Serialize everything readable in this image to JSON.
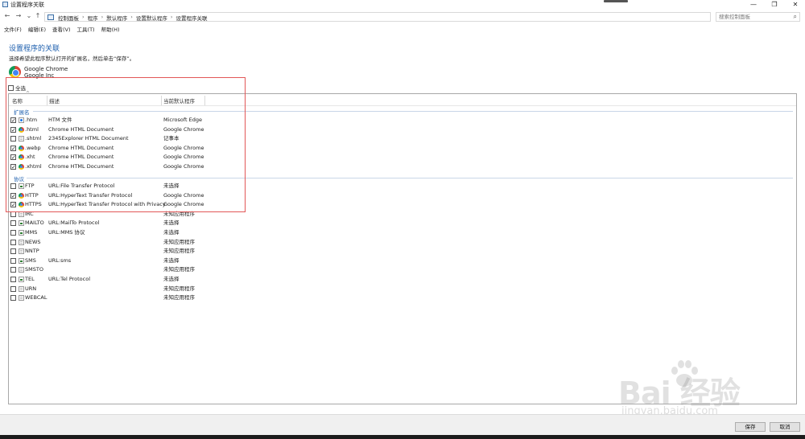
{
  "window": {
    "title": "设置程序关联",
    "minimize_icon": "—",
    "maximize_icon": "❐",
    "close_icon": "✕"
  },
  "address": {
    "back_icon": "←",
    "forward_icon": "→",
    "recent_icon": "⌄",
    "up_icon": "↑",
    "crumbs": [
      "控制面板",
      "程序",
      "默认程序",
      "设置默认程序",
      "设置程序关联"
    ],
    "separator": "›",
    "dropdown_icon": "⌄",
    "refresh_icon": "↻",
    "search_placeholder": "搜索控制面板",
    "search_icon": "⌕"
  },
  "menu": [
    "文件(F)",
    "编辑(E)",
    "查看(V)",
    "工具(T)",
    "帮助(H)"
  ],
  "page": {
    "title": "设置程序的关联",
    "description": "选择希望此程序默认打开的扩展名，然后单击“保存”。",
    "app_name": "Google Chrome",
    "app_vendor": "Google Inc",
    "select_all_label": "全选",
    "select_all_checked": false
  },
  "table": {
    "columns": [
      "名称",
      "描述",
      "当前默认程序"
    ],
    "sort_indicator": "^",
    "groups": {
      "extensions": "扩展名",
      "protocols": "协议"
    },
    "extension_rows": [
      {
        "checked": true,
        "icon": "edge-icon",
        "name": ".htm",
        "desc": "HTM 文件",
        "default": "Microsoft Edge"
      },
      {
        "checked": true,
        "icon": "chrome-icon",
        "name": ".html",
        "desc": "Chrome HTML Document",
        "default": "Google Chrome"
      },
      {
        "checked": false,
        "icon": "file-icon",
        "name": ".shtml",
        "desc": "2345Explorer HTML Document",
        "default": "记事本"
      },
      {
        "checked": true,
        "icon": "chrome-icon",
        "name": ".webp",
        "desc": "Chrome HTML Document",
        "default": "Google Chrome"
      },
      {
        "checked": true,
        "icon": "chrome-icon",
        "name": ".xht",
        "desc": "Chrome HTML Document",
        "default": "Google Chrome"
      },
      {
        "checked": true,
        "icon": "chrome-icon",
        "name": ".xhtml",
        "desc": "Chrome HTML Document",
        "default": "Google Chrome"
      }
    ],
    "protocol_rows": [
      {
        "checked": false,
        "icon": "link-icon",
        "name": "FTP",
        "desc": "URL:File Transfer Protocol",
        "default": "未选择"
      },
      {
        "checked": true,
        "icon": "chrome-icon",
        "name": "HTTP",
        "desc": "URL:HyperText Transfer Protocol",
        "default": "Google Chrome"
      },
      {
        "checked": true,
        "icon": "chrome-icon",
        "name": "HTTPS",
        "desc": "URL:HyperText Transfer Protocol with Privacy",
        "default": "Google Chrome"
      },
      {
        "checked": false,
        "icon": "file-icon",
        "name": "IRC",
        "desc": "",
        "default": "未知应用程序"
      },
      {
        "checked": false,
        "icon": "link-icon",
        "name": "MAILTO",
        "desc": "URL:MailTo Protocol",
        "default": "未选择"
      },
      {
        "checked": false,
        "icon": "link-icon",
        "name": "MMS",
        "desc": "URL:MMS 协议",
        "default": "未选择"
      },
      {
        "checked": false,
        "icon": "file-icon",
        "name": "NEWS",
        "desc": "",
        "default": "未知应用程序"
      },
      {
        "checked": false,
        "icon": "file-icon",
        "name": "NNTP",
        "desc": "",
        "default": "未知应用程序"
      },
      {
        "checked": false,
        "icon": "link-icon",
        "name": "SMS",
        "desc": "URL:sms",
        "default": "未选择"
      },
      {
        "checked": false,
        "icon": "file-icon",
        "name": "SMSTO",
        "desc": "",
        "default": "未知应用程序"
      },
      {
        "checked": false,
        "icon": "link-icon",
        "name": "TEL",
        "desc": "URL:Tel Protocol",
        "default": "未选择"
      },
      {
        "checked": false,
        "icon": "file-icon",
        "name": "URN",
        "desc": "",
        "default": "未知应用程序"
      },
      {
        "checked": false,
        "icon": "file-icon",
        "name": "WEBCAL",
        "desc": "",
        "default": "未知应用程序"
      }
    ]
  },
  "buttons": {
    "save": "保存",
    "cancel": "取消"
  },
  "watermark": {
    "logo_text": "Bai 经验",
    "url": "jingyan.baidu.com"
  },
  "colors": {
    "accent": "#1e5fae",
    "highlight_box": "#e25757"
  }
}
